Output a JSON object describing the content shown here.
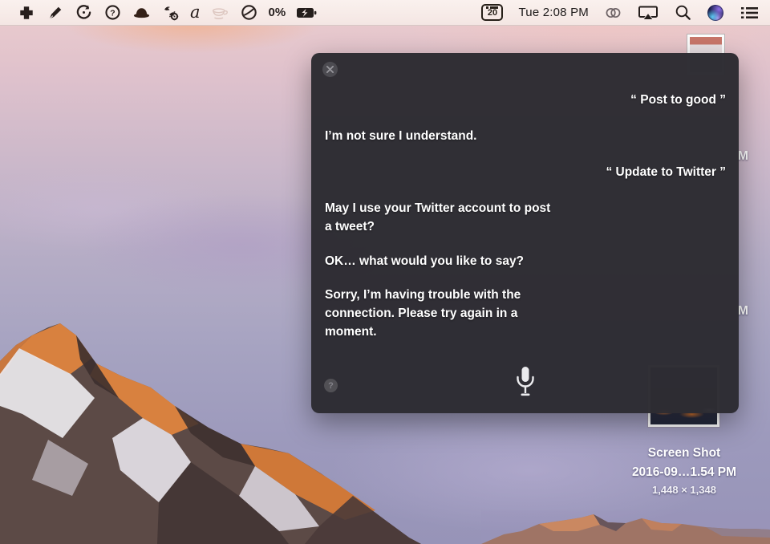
{
  "menu_bar": {
    "left_icons": [
      "plus-icon",
      "pen-icon",
      "history-icon",
      "circled-question-icon",
      "bowler-hat-icon",
      "automation-gear-icon",
      "script-a-icon",
      "coffee-cup-icon",
      "circle-chord-icon"
    ],
    "battery_percent": "0%",
    "battery_state": "charging",
    "calendar_day": "20",
    "clock": "Tue 2:08 PM",
    "right_icons": [
      "linked-rings-icon",
      "airplay-icon",
      "spotlight-icon",
      "siri-icon",
      "notification-list-icon"
    ]
  },
  "siri_panel": {
    "help_label": "?",
    "messages": [
      {
        "role": "user",
        "text": "“ Post to good ”"
      },
      {
        "role": "assistant",
        "text": "I’m not sure I understand."
      },
      {
        "role": "user",
        "text": "“ Update to Twitter ”"
      },
      {
        "role": "assistant",
        "text": "May I use your Twitter account to post a tweet?"
      },
      {
        "role": "assistant",
        "text": "OK… what would you like to say?"
      },
      {
        "role": "assistant",
        "text": "Sorry, I’m having trouble with the connection. Please try again in a moment."
      }
    ]
  },
  "desktop": {
    "file_label_line1": "Screen Shot",
    "file_label_line2": "2016-09…1.54 PM",
    "file_dimensions": "1,448 × 1,348",
    "partial_label_top": "M",
    "partial_label_bottom": "M"
  },
  "colors": {
    "menu_bar_bg": "#f7ebe8",
    "siri_window_bg": "#2d2c32",
    "sunlit_rock": "#d8813f",
    "sky_top": "#eccdce",
    "sky_bottom": "#9794b8"
  }
}
